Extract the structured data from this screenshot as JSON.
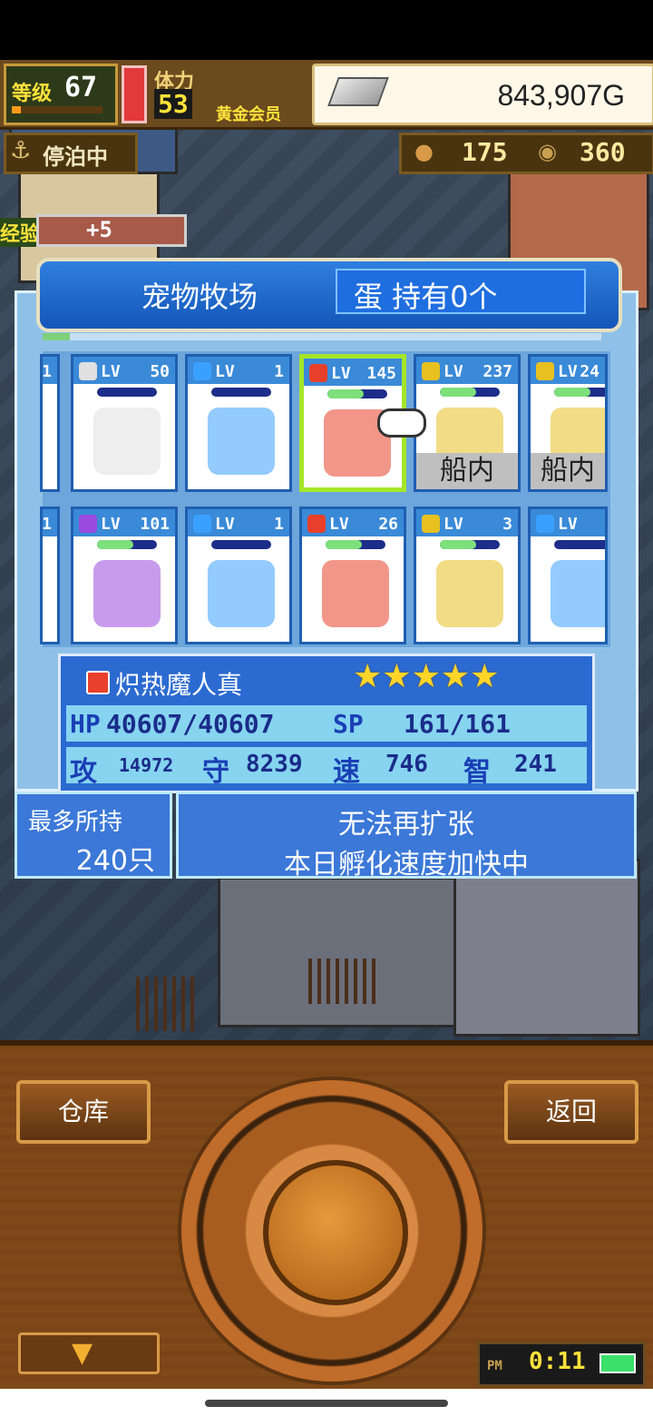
{
  "hud": {
    "level_label": "等级",
    "level_value": "67",
    "stamina_label": "体力",
    "stamina_value": "53",
    "member_label": "黄金会员",
    "gold": "843,907G",
    "docked_label": "停泊中",
    "food_count": "175",
    "coin_count": "360",
    "exp_label": "经验",
    "exp_bonus": "+5"
  },
  "ranch": {
    "title": "宠物牧场",
    "eggs": "蛋 持有0个",
    "row1": [
      {
        "lv": "1",
        "lv_label": "",
        "element": "none",
        "label": ""
      },
      {
        "lv": "50",
        "lv_label": "LV",
        "element": "white",
        "label": ""
      },
      {
        "lv": "1",
        "lv_label": "LV",
        "element": "water",
        "label": ""
      },
      {
        "lv": "145",
        "lv_label": "LV",
        "element": "fire",
        "label": ""
      },
      {
        "lv": "237",
        "lv_label": "LV",
        "element": "thunder",
        "label": "船内"
      },
      {
        "lv": "24",
        "lv_label": "LV",
        "element": "thunder",
        "label": "船内"
      }
    ],
    "row2": [
      {
        "lv": "1",
        "lv_label": "",
        "element": "none",
        "label": ""
      },
      {
        "lv": "101",
        "lv_label": "LV",
        "element": "dark",
        "label": ""
      },
      {
        "lv": "1",
        "lv_label": "LV",
        "element": "water",
        "label": ""
      },
      {
        "lv": "26",
        "lv_label": "LV",
        "element": "fire",
        "label": ""
      },
      {
        "lv": "3",
        "lv_label": "LV",
        "element": "thunder",
        "label": ""
      },
      {
        "lv": "",
        "lv_label": "LV",
        "element": "water",
        "label": ""
      }
    ]
  },
  "selected_pet": {
    "name": "炽热魔人真",
    "stars": 5,
    "hp_label": "HP",
    "hp": "40607/40607",
    "sp_label": "SP",
    "sp": "161/161",
    "atk_label": "攻",
    "atk": "14972",
    "def_label": "守",
    "def": "8239",
    "spd_label": "速",
    "spd": "746",
    "int_label": "智",
    "int": "241"
  },
  "capacity": {
    "label": "最多所持",
    "value": "240只"
  },
  "notice": {
    "line1": "无法再扩张",
    "line2": "本日孵化速度加快中"
  },
  "controls": {
    "warehouse": "仓库",
    "back": "返回"
  },
  "clock": {
    "ampm": "PM",
    "time": "0:11"
  },
  "colors": {
    "ranch_blue": "#2b6ad1",
    "select_green": "#a4e628",
    "star_yellow": "#ffd52a",
    "wood": "#7a4416"
  }
}
